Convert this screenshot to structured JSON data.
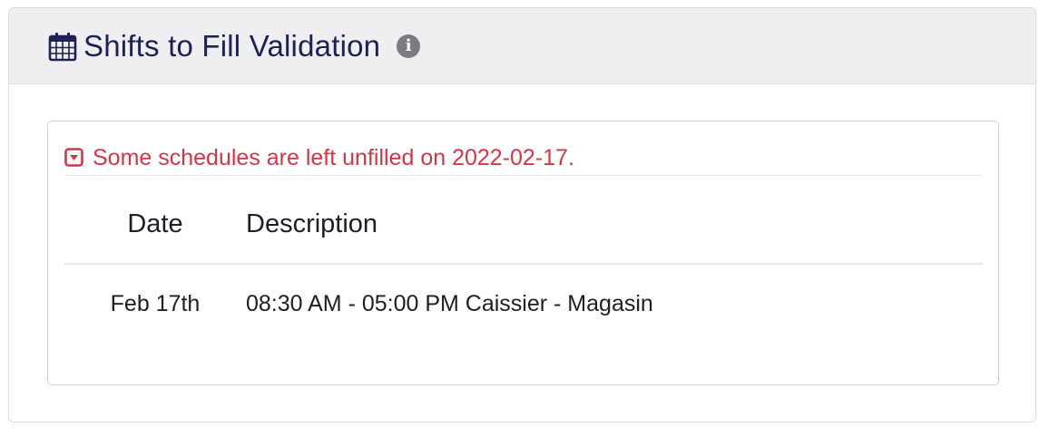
{
  "header": {
    "title": "Shifts to Fill Validation",
    "title_icon": "calendar-icon",
    "info_icon": "info-icon"
  },
  "alert": {
    "message": "Some schedules are left unfilled on 2022-02-17.",
    "toggle_icon": "caret-square-down-icon",
    "color": "#d63447"
  },
  "table": {
    "headers": {
      "date": "Date",
      "description": "Description"
    },
    "rows": [
      {
        "date": "Feb 17th",
        "description": "08:30 AM - 05:00 PM Caissier - Magasin"
      }
    ]
  },
  "colors": {
    "header_bg": "#efeef1",
    "title_text": "#1c2254",
    "alert_red": "#d63447"
  }
}
